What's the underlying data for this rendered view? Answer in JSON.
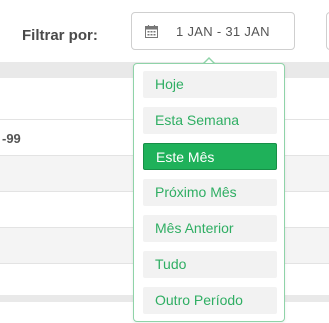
{
  "filter": {
    "label": "Filtrar por:",
    "date_range": "1 JAN - 31 JAN",
    "icon": "calendar-icon"
  },
  "table": {
    "visible_cell_text": "-99"
  },
  "dropdown": {
    "options": [
      {
        "label": "Hoje",
        "selected": false
      },
      {
        "label": "Esta Semana",
        "selected": false
      },
      {
        "label": "Este Mês",
        "selected": true
      },
      {
        "label": "Próximo Mês",
        "selected": false
      },
      {
        "label": "Mês Anterior",
        "selected": false
      },
      {
        "label": "Tudo",
        "selected": false
      },
      {
        "label": "Outro Período",
        "selected": false
      }
    ]
  },
  "colors": {
    "accent": "#1fb15a",
    "option_text": "#2fae63",
    "dropdown_border": "#8fd3a8",
    "table_background": "#e9e9e9"
  }
}
